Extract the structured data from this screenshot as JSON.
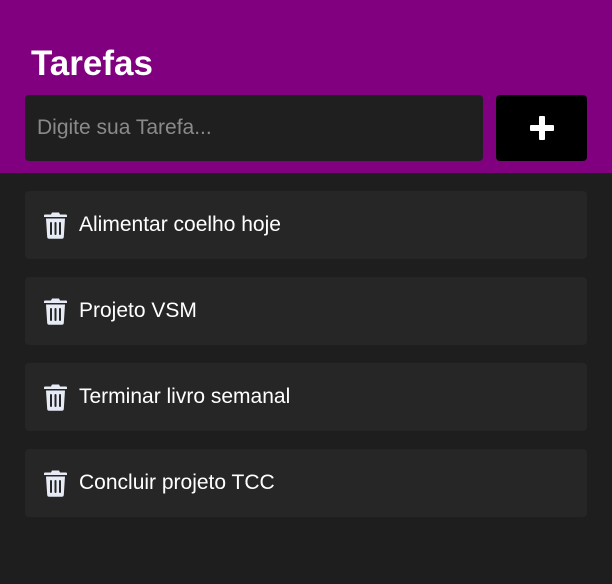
{
  "header": {
    "title": "Tarefas",
    "background_color": "#800080"
  },
  "input": {
    "placeholder": "Digite sua Tarefa...",
    "value": ""
  },
  "add_button": {
    "icon": "plus-icon"
  },
  "tasks": [
    {
      "text": "Alimentar coelho hoje",
      "icon": "trash-icon"
    },
    {
      "text": "Projeto VSM",
      "icon": "trash-icon"
    },
    {
      "text": "Terminar livro semanal",
      "icon": "trash-icon"
    },
    {
      "text": "Concluir projeto TCC",
      "icon": "trash-icon"
    }
  ]
}
